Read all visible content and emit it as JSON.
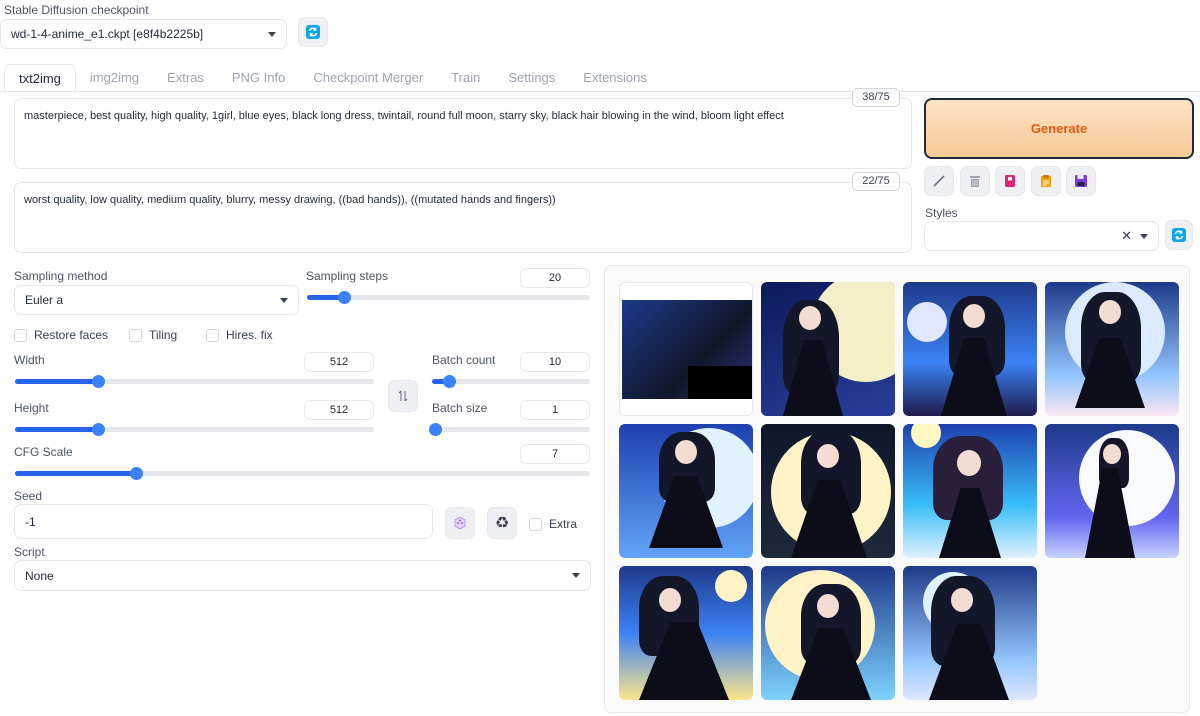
{
  "checkpoint": {
    "label": "Stable Diffusion checkpoint",
    "value": "wd-1-4-anime_e1.ckpt [e8f4b2225b]"
  },
  "tabs": [
    "txt2img",
    "img2img",
    "Extras",
    "PNG Info",
    "Checkpoint Merger",
    "Train",
    "Settings",
    "Extensions"
  ],
  "prompt": {
    "positive": "masterpiece, best quality, high quality, 1girl, blue eyes, black long dress, twintail, round full moon, starry sky, black hair blowing in the wind, bloom light effect",
    "positive_count": "38/75",
    "negative": "worst quality, low quality, medium quality, blurry, messy drawing, ((bad hands)), ((mutated hands and fingers))",
    "negative_count": "22/75"
  },
  "generate_label": "Generate",
  "styles_label": "Styles",
  "sampling": {
    "method_label": "Sampling method",
    "method_value": "Euler a",
    "steps_label": "Sampling steps",
    "steps_value": "20",
    "steps_fraction": 0.13
  },
  "checks": {
    "restore_faces": "Restore faces",
    "tiling": "Tiling",
    "hires": "Hires. fix",
    "extra": "Extra"
  },
  "width": {
    "label": "Width",
    "value": "512",
    "fraction": 0.23
  },
  "height": {
    "label": "Height",
    "value": "512",
    "fraction": 0.23
  },
  "batch_count": {
    "label": "Batch count",
    "value": "10",
    "fraction": 0.11
  },
  "batch_size": {
    "label": "Batch size",
    "value": "1",
    "fraction": 0.02
  },
  "cfg": {
    "label": "CFG Scale",
    "value": "7",
    "fraction": 0.21
  },
  "seed": {
    "label": "Seed",
    "value": "-1"
  },
  "script": {
    "label": "Script",
    "value": "None"
  },
  "colors": {
    "accent": "#2563eb",
    "generate_bg": "#fcd6a8",
    "generate_text": "#ea580c"
  },
  "icons": [
    "refresh-icon",
    "pencil-icon",
    "trash-icon",
    "bookmark-icon",
    "clipboard-icon",
    "save-icon",
    "swap-icon",
    "dice-icon",
    "recycle-icon",
    "clear-icon"
  ]
}
